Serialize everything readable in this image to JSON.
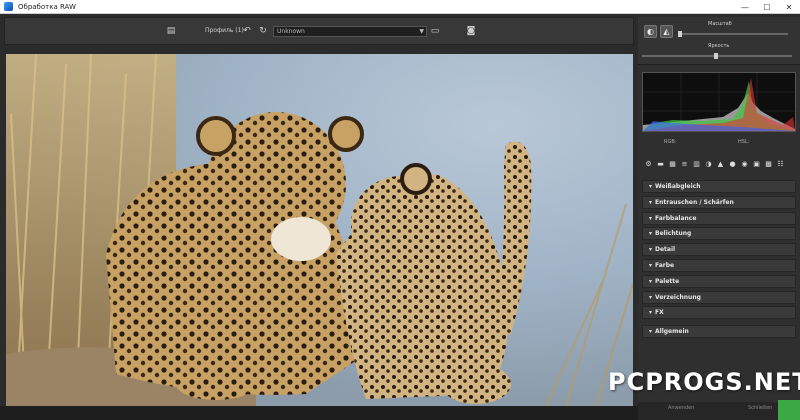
{
  "window": {
    "title": "Обработка RAW",
    "controls": [
      "—",
      "☐",
      "✕"
    ]
  },
  "toolbar": {
    "profile_label": "Профиль (1)",
    "profile_value": "Unknown"
  },
  "right_panel": {
    "slider1_label": "Масштаб",
    "slider2_label": "Яркость",
    "hist_rgb_label": "RGB:",
    "hist_hsl_label": "HSL:",
    "sections": [
      "Weißabgleich",
      "Entrauschen / Schärfen",
      "Farbbalance",
      "Belichtung",
      "Detail",
      "Farbe",
      "Palette",
      "Verzeichnung",
      "FX",
      "Allgemein"
    ],
    "bottom_left": "Anwenden",
    "bottom_right": "Schließen"
  },
  "watermark": "PCPROGS.NET",
  "colors": {
    "accent_green": "#3aa845",
    "panel": "#2f2f2f",
    "background": "#2b2b2b"
  }
}
